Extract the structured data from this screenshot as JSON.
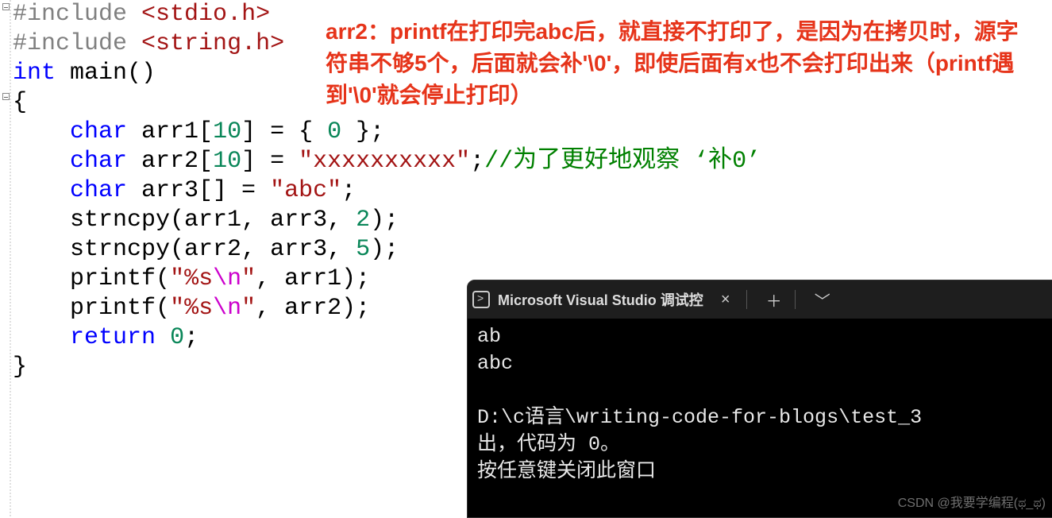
{
  "code": {
    "line1_include_kw": "#include",
    "line1_header": "<stdio.h>",
    "line2_include_kw": "#include",
    "line2_header": "<string.h>",
    "line3_kw_int": "int",
    "line3_main": " main",
    "line3_parens": "()",
    "line4_brace": "{",
    "line5_kw": "char",
    "line5_id": " arr1",
    "line5_rest1": "[",
    "line5_num1": "10",
    "line5_rest2": "] = { ",
    "line5_num2": "0",
    "line5_rest3": " };",
    "line6_kw": "char",
    "line6_id": " arr2",
    "line6_rest1": "[",
    "line6_num1": "10",
    "line6_rest2": "] = ",
    "line6_str": "\"xxxxxxxxxx\"",
    "line6_semi": ";",
    "line6_cmt": "//为了更好地观察 ‘补0’",
    "line7_kw": "char",
    "line7_id": " arr3",
    "line7_rest1": "[] = ",
    "line7_str": "\"abc\"",
    "line7_semi": ";",
    "line8_fn": "strncpy",
    "line8_args": "(arr1, arr3, ",
    "line8_num": "2",
    "line8_end": ");",
    "line9_fn": "strncpy",
    "line9_args": "(arr2, arr3, ",
    "line9_num": "5",
    "line9_end": ");",
    "line10_fn": "printf",
    "line10_open": "(",
    "line10_str1": "\"%s",
    "line10_esc": "\\n",
    "line10_str2": "\"",
    "line10_rest": ", arr1);",
    "line11_fn": "printf",
    "line11_open": "(",
    "line11_str1": "\"%s",
    "line11_esc": "\\n",
    "line11_str2": "\"",
    "line11_rest": ", arr2);",
    "line12_kw": "return",
    "line12_rest": " ",
    "line12_num": "0",
    "line12_semi": ";",
    "line13_brace": "}"
  },
  "annotation": {
    "text": "arr2：printf在打印完abc后，就直接不打印了，是因为在拷贝时，源字符串不够5个，后面就会补'\\0'，即使后面有x也不会打印出来（printf遇到'\\0'就会停止打印）"
  },
  "terminal": {
    "title": "Microsoft Visual Studio 调试控",
    "output_line1": "ab",
    "output_line2": "abc",
    "output_line3": "",
    "output_line4": "D:\\c语言\\writing-code-for-blogs\\test_3",
    "output_line5": "出，代码为 0。",
    "output_line6": "按任意键关闭此窗口",
    "watermark": "CSDN @我要学编程(ಥ_ಥ)"
  }
}
